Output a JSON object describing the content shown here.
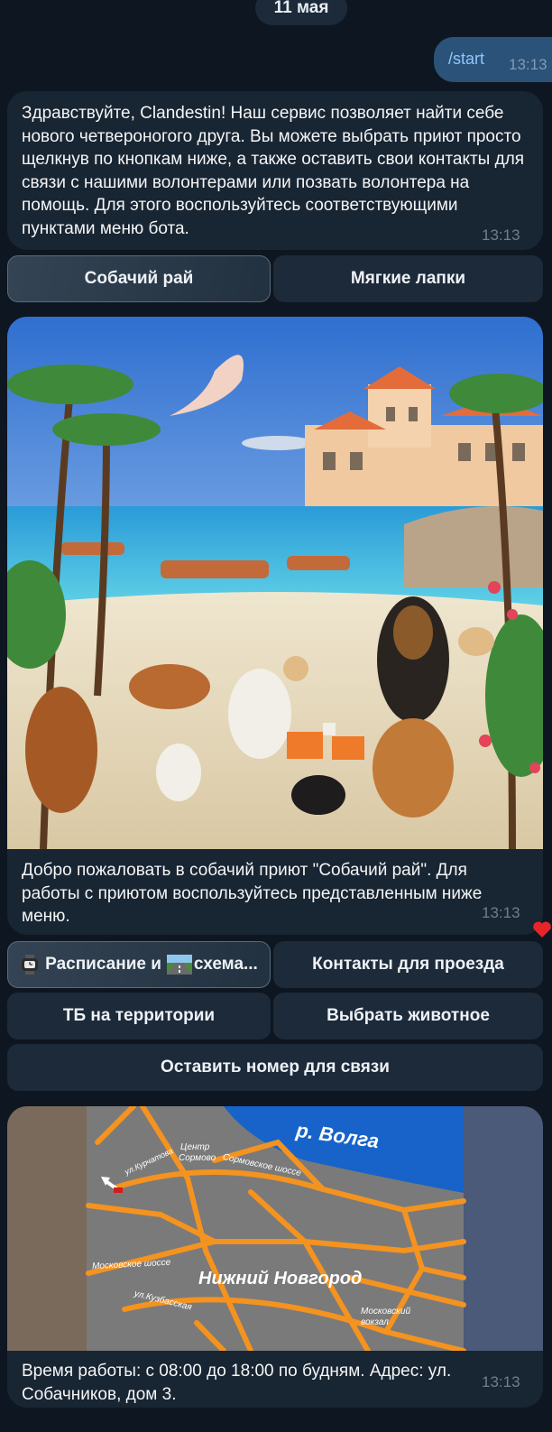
{
  "date_separator": "11 мая",
  "outgoing": {
    "text": "/start",
    "time": "13:13"
  },
  "messages": [
    {
      "text": "Здравствуйте, Clandestin! Наш сервис позволяет найти себе нового четвероногого друга. Вы можете выбрать приют просто щелкнув по кнопкам ниже, а также оставить свои контакты для связи с нашими волонтерами или позвать волонтера на помощь. Для этого воспользуйтесь соответствующими пунктами меню бота.",
      "time": "13:13"
    },
    {
      "text": "Добро пожаловать в собачий приют \"Собачий рай\". Для работы с приютом воспользуйтесь представленным ниже меню.",
      "time": "13:13"
    },
    {
      "text": "Время работы: с 08:00 до 18:00 по будням. Адрес: ул. Собачников, дом 3.",
      "time": "13:13"
    }
  ],
  "keyboard1": [
    "Собачий рай",
    "Мягкие лапки"
  ],
  "keyboard2": {
    "schedule_a": "Расписание и",
    "schedule_b": "схема...",
    "contacts": "Контакты для проезда",
    "safety": "ТБ на территории",
    "choose": "Выбрать животное",
    "leave_phone": "Оставить номер для связи"
  },
  "map": {
    "river": "р. Волга",
    "center": "Центр",
    "sormovo": "Сормово",
    "sormovskoe": "Сормовское шоссе",
    "kurchatova": "ул.Курчатова",
    "moskovskoe": "Московское шоссе",
    "kuzbasskaya": "ул.Кузбасская",
    "city": "Нижний Новгород",
    "station": "Московский вокзал"
  },
  "reaction": "heart-icon",
  "colors": {
    "bg": "#0e1621",
    "bubble": "#182533",
    "outgoing": "#2b5278",
    "key": "#1c2a3a"
  }
}
